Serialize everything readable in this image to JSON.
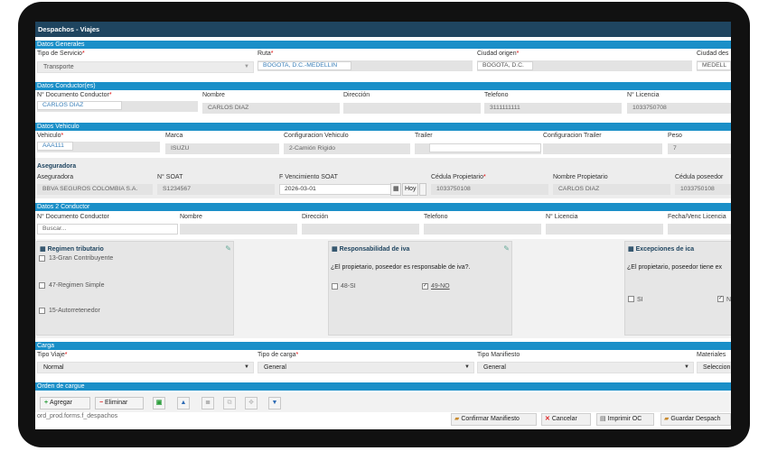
{
  "window": {
    "title": "Despachos - Viajes"
  },
  "sections": {
    "datos_generales": "Datos Generales",
    "datos_conductor": "Datos Conductor(es)",
    "datos_vehiculo": "Datos Vehiculo",
    "aseguradora": "Aseguradora",
    "datos2_conductor": "Datos 2 Conductor",
    "carga": "Carga",
    "orden_cargue": "Orden de cargue"
  },
  "generales": {
    "tipo_servicio_label": "Tipo de Servicio",
    "tipo_servicio_value": "Transporte",
    "ruta_label": "Ruta",
    "ruta_value": "BOGOTA, D.C.-MEDELLIN",
    "ciudad_origen_label": "Ciudad origen",
    "ciudad_origen_value": "BOGOTA, D.C.",
    "ciudad_destino_label": "Ciudad des",
    "ciudad_destino_value": "MEDELL"
  },
  "conductor": {
    "doc_label": "N° Documento Conductor",
    "doc_value": "CARLOS DIAZ",
    "nombre_label": "Nombre",
    "nombre_value": "CARLOS DIAZ",
    "direccion_label": "Dirección",
    "telefono_label": "Telefono",
    "telefono_value": "3111111111",
    "licencia_label": "N° Licencia",
    "licencia_value": "1033750708"
  },
  "vehiculo": {
    "vehiculo_label": "Vehiculo",
    "vehiculo_value": "AAA111",
    "marca_label": "Marca",
    "marca_value": "ISUZU",
    "config_label": "Configuracion Vehiculo",
    "config_value": "2-Camión Rígido",
    "trailer_label": "Trailer",
    "config_trailer_label": "Configuracion Trailer",
    "peso_label": "Peso",
    "peso_value": "7"
  },
  "aseguradora": {
    "aseguradora_label": "Aseguradora",
    "aseguradora_value": "BBVA SEGUROS COLOMBIA S.A.",
    "soat_label": "N° SOAT",
    "soat_value": "S1234567",
    "venc_label": "F Vencimiento SOAT",
    "venc_value": "2026-03-01",
    "hoy_label": "Hoy",
    "cedula_prop_label": "Cédula Propietario",
    "cedula_prop_value": "1033750108",
    "nombre_prop_label": "Nombre Propietario",
    "nombre_prop_value": "CARLOS DIAZ",
    "cedula_pos_label": "Cédula poseedor",
    "cedula_pos_value": "1033750108"
  },
  "conductor2": {
    "doc_label": "N° Documento Conductor",
    "doc_placeholder": "Buscar...",
    "nombre_label": "Nombre",
    "direccion_label": "Dirección",
    "telefono_label": "Telefono",
    "licencia_label": "N° Licencia",
    "fecha_label": "Fecha/Venc Licencia"
  },
  "regimen": {
    "title": "Regimen tributario",
    "items": [
      "13-Gran Contribuyente",
      "47-Regimen Simple",
      "15-Autorretenedor"
    ]
  },
  "iva": {
    "title": "Responsabilidad de iva",
    "question": "¿El propietario, poseedor es responsable de iva?.",
    "opt_si": "48-SI",
    "opt_no": "49-NO"
  },
  "ica": {
    "title": "Excepciones de ica",
    "question": "¿El propietario, poseedor tiene ex",
    "opt_si": "SI",
    "opt_no": "N"
  },
  "carga": {
    "tipo_viaje_label": "Tipo Viaje",
    "tipo_viaje_value": "Normal",
    "tipo_carga_label": "Tipo de carga",
    "tipo_carga_value": "General",
    "tipo_manifiesto_label": "Tipo Manifiesto",
    "tipo_manifiesto_value": "General",
    "materiales_label": "Materiales",
    "materiales_value": "Seleccion"
  },
  "toolbar": {
    "agregar": "Agregar",
    "eliminar": "Eliminar"
  },
  "footer": {
    "path": "ord_prod.forms.f_despachos",
    "confirmar": "Confirmar Manifiesto",
    "cancelar": "Cancelar",
    "imprimir": "Imprimir OC",
    "guardar": "Guardar Despach"
  }
}
